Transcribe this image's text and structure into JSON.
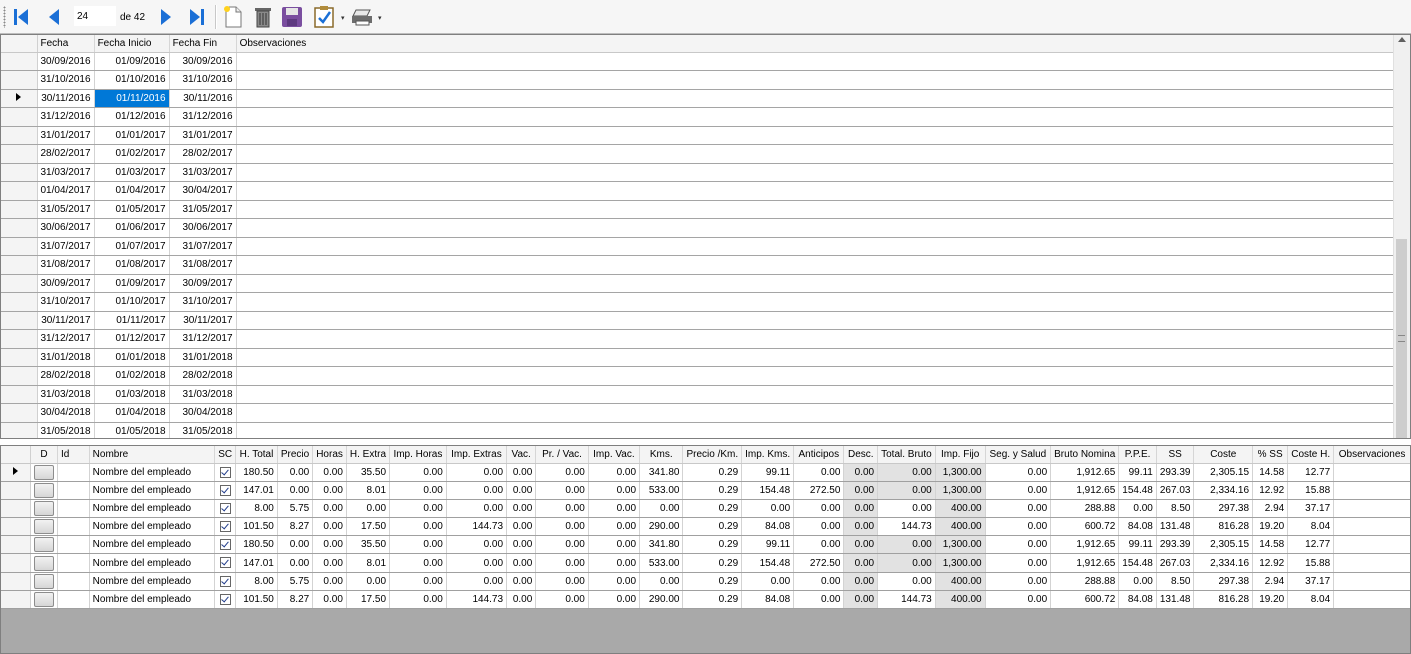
{
  "toolbar": {
    "position": "24",
    "of_label": "de 42",
    "icons": [
      "first-record-icon",
      "previous-record-icon",
      "next-record-icon",
      "last-record-icon",
      "new-document-icon",
      "delete-trash-icon",
      "save-floppy-icon",
      "validate-checklist-icon",
      "printer-icon"
    ],
    "accent": "#1a6fd6"
  },
  "top_grid": {
    "columns": [
      "Fecha",
      "Fecha Inicio",
      "Fecha Fin",
      "Observaciones"
    ],
    "current_row": 2,
    "selected_cell": {
      "row": 2,
      "col": 1
    },
    "selection_color": "#0078d7",
    "rows": [
      [
        "30/09/2016",
        "01/09/2016",
        "30/09/2016",
        ""
      ],
      [
        "31/10/2016",
        "01/10/2016",
        "31/10/2016",
        ""
      ],
      [
        "30/11/2016",
        "01/11/2016",
        "30/11/2016",
        ""
      ],
      [
        "31/12/2016",
        "01/12/2016",
        "31/12/2016",
        ""
      ],
      [
        "31/01/2017",
        "01/01/2017",
        "31/01/2017",
        ""
      ],
      [
        "28/02/2017",
        "01/02/2017",
        "28/02/2017",
        ""
      ],
      [
        "31/03/2017",
        "01/03/2017",
        "31/03/2017",
        ""
      ],
      [
        "01/04/2017",
        "01/04/2017",
        "30/04/2017",
        ""
      ],
      [
        "31/05/2017",
        "01/05/2017",
        "31/05/2017",
        ""
      ],
      [
        "30/06/2017",
        "01/06/2017",
        "30/06/2017",
        ""
      ],
      [
        "31/07/2017",
        "01/07/2017",
        "31/07/2017",
        ""
      ],
      [
        "31/08/2017",
        "01/08/2017",
        "31/08/2017",
        ""
      ],
      [
        "30/09/2017",
        "01/09/2017",
        "30/09/2017",
        ""
      ],
      [
        "31/10/2017",
        "01/10/2017",
        "31/10/2017",
        ""
      ],
      [
        "30/11/2017",
        "01/11/2017",
        "30/11/2017",
        ""
      ],
      [
        "31/12/2017",
        "01/12/2017",
        "31/12/2017",
        ""
      ],
      [
        "31/01/2018",
        "01/01/2018",
        "31/01/2018",
        ""
      ],
      [
        "28/02/2018",
        "01/02/2018",
        "28/02/2018",
        ""
      ],
      [
        "31/03/2018",
        "01/03/2018",
        "31/03/2018",
        ""
      ],
      [
        "30/04/2018",
        "01/04/2018",
        "30/04/2018",
        ""
      ],
      [
        "31/05/2018",
        "01/05/2018",
        "31/05/2018",
        ""
      ]
    ]
  },
  "bottom_grid": {
    "columns": [
      "D",
      "Id",
      "Nombre",
      "SC",
      "H. Total",
      "Precio",
      "Horas",
      "H. Extra",
      "Imp. Horas",
      "Imp. Extras",
      "Vac.",
      "Pr. / Vac.",
      "Imp. Vac.",
      "Kms.",
      "Precio /Km.",
      "Imp. Kms.",
      "Anticipos",
      "Desc.",
      "Total. Bruto",
      "Imp. Fijo",
      "Seg. y Salud",
      "Bruto Nomina",
      "P.P.E.",
      "SS",
      "Coste",
      "% SS",
      "Coste H.",
      "Observaciones"
    ],
    "current_row": 0,
    "shaded_color": "#e2e2e2",
    "rows": [
      {
        "id": "",
        "nombre": "Nombre del empleado",
        "sc": true,
        "v": [
          "180.50",
          "0.00",
          "0.00",
          "35.50",
          "0.00",
          "0.00",
          "0.00",
          "0.00",
          "0.00",
          "341.80",
          "0.29",
          "99.11",
          "0.00",
          "0.00",
          "0.00",
          "1,300.00",
          "0.00",
          "1,912.65",
          "99.11",
          "293.39",
          "2,305.15",
          "14.58",
          "12.77",
          ""
        ]
      },
      {
        "id": "",
        "nombre": "Nombre del empleado",
        "sc": true,
        "v": [
          "147.01",
          "0.00",
          "0.00",
          "8.01",
          "0.00",
          "0.00",
          "0.00",
          "0.00",
          "0.00",
          "533.00",
          "0.29",
          "154.48",
          "272.50",
          "0.00",
          "0.00",
          "1,300.00",
          "0.00",
          "1,912.65",
          "154.48",
          "267.03",
          "2,334.16",
          "12.92",
          "15.88",
          ""
        ]
      },
      {
        "id": "",
        "nombre": "Nombre del empleado",
        "sc": true,
        "v": [
          "8.00",
          "5.75",
          "0.00",
          "0.00",
          "0.00",
          "0.00",
          "0.00",
          "0.00",
          "0.00",
          "0.00",
          "0.29",
          "0.00",
          "0.00",
          "0.00",
          "0.00",
          "400.00",
          "0.00",
          "288.88",
          "0.00",
          "8.50",
          "297.38",
          "2.94",
          "37.17",
          ""
        ]
      },
      {
        "id": "",
        "nombre": "Nombre del empleado",
        "sc": true,
        "v": [
          "101.50",
          "8.27",
          "0.00",
          "17.50",
          "0.00",
          "144.73",
          "0.00",
          "0.00",
          "0.00",
          "290.00",
          "0.29",
          "84.08",
          "0.00",
          "0.00",
          "144.73",
          "400.00",
          "0.00",
          "600.72",
          "84.08",
          "131.48",
          "816.28",
          "19.20",
          "8.04",
          ""
        ]
      },
      {
        "id": "",
        "nombre": "Nombre del empleado",
        "sc": true,
        "v": [
          "180.50",
          "0.00",
          "0.00",
          "35.50",
          "0.00",
          "0.00",
          "0.00",
          "0.00",
          "0.00",
          "341.80",
          "0.29",
          "99.11",
          "0.00",
          "0.00",
          "0.00",
          "1,300.00",
          "0.00",
          "1,912.65",
          "99.11",
          "293.39",
          "2,305.15",
          "14.58",
          "12.77",
          ""
        ]
      },
      {
        "id": "",
        "nombre": "Nombre del empleado",
        "sc": true,
        "v": [
          "147.01",
          "0.00",
          "0.00",
          "8.01",
          "0.00",
          "0.00",
          "0.00",
          "0.00",
          "0.00",
          "533.00",
          "0.29",
          "154.48",
          "272.50",
          "0.00",
          "0.00",
          "1,300.00",
          "0.00",
          "1,912.65",
          "154.48",
          "267.03",
          "2,334.16",
          "12.92",
          "15.88",
          ""
        ]
      },
      {
        "id": "",
        "nombre": "Nombre del empleado",
        "sc": true,
        "v": [
          "8.00",
          "5.75",
          "0.00",
          "0.00",
          "0.00",
          "0.00",
          "0.00",
          "0.00",
          "0.00",
          "0.00",
          "0.29",
          "0.00",
          "0.00",
          "0.00",
          "0.00",
          "400.00",
          "0.00",
          "288.88",
          "0.00",
          "8.50",
          "297.38",
          "2.94",
          "37.17",
          ""
        ]
      },
      {
        "id": "",
        "nombre": "Nombre del empleado",
        "sc": true,
        "v": [
          "101.50",
          "8.27",
          "0.00",
          "17.50",
          "0.00",
          "144.73",
          "0.00",
          "0.00",
          "0.00",
          "290.00",
          "0.29",
          "84.08",
          "0.00",
          "0.00",
          "144.73",
          "400.00",
          "0.00",
          "600.72",
          "84.08",
          "131.48",
          "816.28",
          "19.20",
          "8.04",
          ""
        ]
      }
    ]
  }
}
